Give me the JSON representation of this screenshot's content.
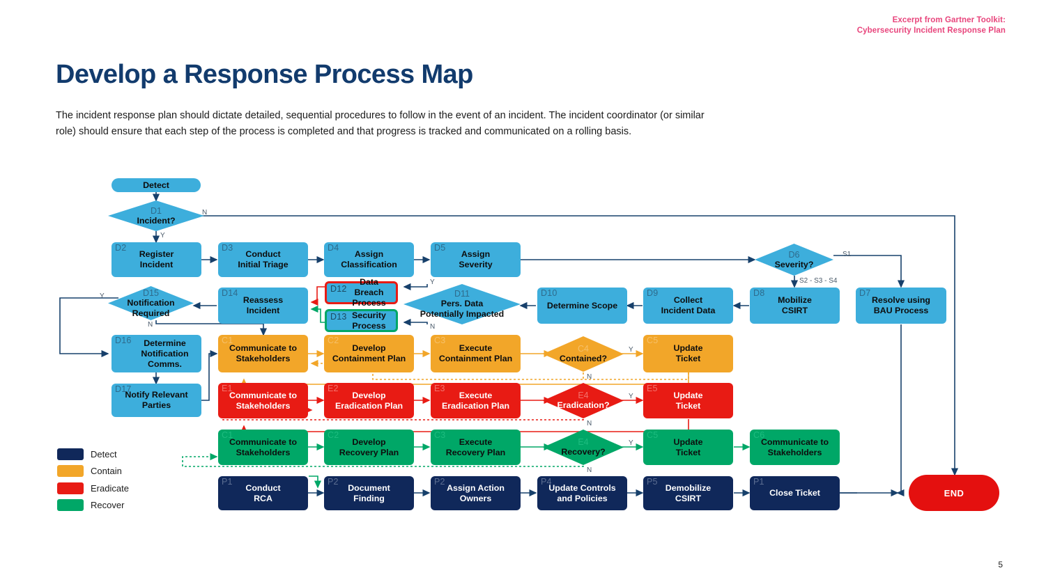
{
  "header": {
    "kicker_line1": "Excerpt from Gartner Toolkit:",
    "kicker_line2": "Cybersecurity Incident Response Plan",
    "kicker_color": "#E8457C",
    "title": "Develop a Response Process Map",
    "title_color": "#123B6D",
    "intro": "The incident response plan should dictate detailed, sequential procedures to follow in the event of an incident. The incident coordinator (or similar role) should ensure that each step of the process is completed and that progress is tracked and communicated on a rolling basis.",
    "page_number": "5"
  },
  "legend": {
    "items": [
      {
        "label": "Detect",
        "color": "#10285A"
      },
      {
        "label": "Contain",
        "color": "#F2A629"
      },
      {
        "label": "Eradicate",
        "color": "#E81B14"
      },
      {
        "label": "Recover",
        "color": "#00A767"
      }
    ]
  },
  "palette": {
    "detect_node": "#3DAEDC",
    "detect_dark": "#10285A",
    "contain": "#F2A629",
    "eradicate": "#E81B14",
    "recover": "#00A767",
    "process": "#10285A",
    "end": "#E4100F",
    "connector": "#17406B"
  },
  "terminators": {
    "start": "Detect",
    "end": "END"
  },
  "nodes": {
    "d1": {
      "tag": "D1",
      "label": "Incident?"
    },
    "d2": {
      "tag": "D2",
      "label": "Register\nIncident"
    },
    "d3": {
      "tag": "D3",
      "label": "Conduct\nInitial Triage"
    },
    "d4": {
      "tag": "D4",
      "label": "Assign\nClassification"
    },
    "d5": {
      "tag": "D5",
      "label": "Assign\nSeverity"
    },
    "d6": {
      "tag": "D6",
      "label": "Severity?"
    },
    "d7": {
      "tag": "D7",
      "label": "Resolve using\nBAU Process"
    },
    "d8": {
      "tag": "D8",
      "label": "Mobilize\nCSIRT"
    },
    "d9": {
      "tag": "D9",
      "label": "Collect\nIncident Data"
    },
    "d10": {
      "tag": "D10",
      "label": "Determine Scope"
    },
    "d11": {
      "tag": "D11",
      "label": "Pers. Data\nPotentially  Impacted"
    },
    "d12": {
      "tag": "D12",
      "label": "Data Breach\nProcess"
    },
    "d13": {
      "tag": "D13",
      "label": "Security\nProcess"
    },
    "d14": {
      "tag": "D14",
      "label": "Reassess\nIncident"
    },
    "d15": {
      "tag": "D15",
      "label": "Notification\nRequired"
    },
    "d16": {
      "tag": "D16",
      "label": "Determine\nNotification\nComms."
    },
    "d17": {
      "tag": "D17",
      "label": "Notify Relevant\nParties"
    },
    "c1": {
      "tag": "C1",
      "label": "Communicate to\nStakeholders"
    },
    "c2": {
      "tag": "C2",
      "label": "Develop\nContainment Plan"
    },
    "c3": {
      "tag": "C3",
      "label": "Execute\nContainment Plan"
    },
    "c4": {
      "tag": "C4",
      "label": "Contained?"
    },
    "c5": {
      "tag": "C5",
      "label": "Update\nTicket"
    },
    "e1": {
      "tag": "E1",
      "label": "Communicate to\nStakeholders"
    },
    "e2": {
      "tag": "E2",
      "label": "Develop\nEradication Plan"
    },
    "e3": {
      "tag": "E3",
      "label": "Execute\nEradication Plan"
    },
    "e4": {
      "tag": "E4",
      "label": "Eradication?"
    },
    "e5": {
      "tag": "E5",
      "label": "Update\nTicket"
    },
    "r1": {
      "tag": "C1",
      "label": "Communicate to\nStakeholders"
    },
    "r2": {
      "tag": "C2",
      "label": "Develop\nRecovery Plan"
    },
    "r3": {
      "tag": "C3",
      "label": "Execute\nRecovery Plan"
    },
    "r4": {
      "tag": "E4",
      "label": "Recovery?"
    },
    "r5": {
      "tag": "C5",
      "label": "Update\nTicket"
    },
    "r6": {
      "tag": "C6",
      "label": "Communicate to\nStakeholders"
    },
    "p1": {
      "tag": "P1",
      "label": "Conduct\nRCA"
    },
    "p2": {
      "tag": "P2",
      "label": "Document\nFinding"
    },
    "p3": {
      "tag": "P2",
      "label": "Assign Action\nOwners"
    },
    "p4": {
      "tag": "P4",
      "label": "Update Controls\nand Policies"
    },
    "p5": {
      "tag": "P5",
      "label": "Demobilize\nCSIRT"
    },
    "p6": {
      "tag": "P1",
      "label": "Close Ticket"
    }
  },
  "edge_labels": {
    "d1_n": "N",
    "d1_y": "Y",
    "d6_s1": "S1",
    "d6_s234": "S2 - S3 - S4",
    "d11_y": "Y",
    "d11_n": "N",
    "d15_y": "Y",
    "d15_n": "N",
    "c4_y": "Y",
    "c4_n": "N",
    "e4_y": "Y",
    "e4_n": "N",
    "r4_y": "Y",
    "r4_n": "N"
  }
}
